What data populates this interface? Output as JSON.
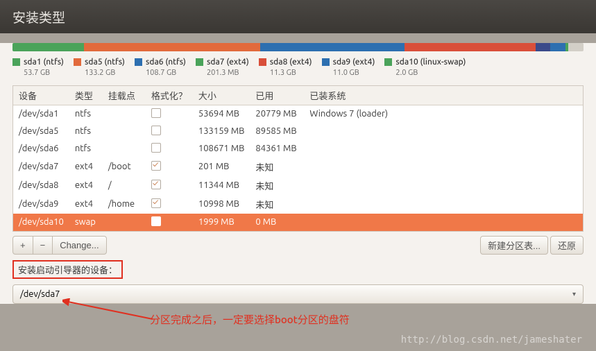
{
  "title": "安装类型",
  "usage_bar": [
    {
      "color": "#4aa35a",
      "pct": 12.5
    },
    {
      "color": "#e26a3c",
      "pct": 30.9
    },
    {
      "color": "#2d6fb0",
      "pct": 25.2
    },
    {
      "color": "#d94f3a",
      "pct": 23.0
    },
    {
      "color": "#3b4a8a",
      "pct": 2.6
    },
    {
      "color": "#2d6fb0",
      "pct": 2.6
    },
    {
      "color": "#4aa35a",
      "pct": 0.5
    },
    {
      "color": "#d3cfc7",
      "pct": 2.7
    }
  ],
  "legend": [
    {
      "color": "#4aa35a",
      "name": "sda1 (ntfs)",
      "size": "53.7 GB"
    },
    {
      "color": "#e26a3c",
      "name": "sda5 (ntfs)",
      "size": "133.2 GB"
    },
    {
      "color": "#2d6fb0",
      "name": "sda6 (ntfs)",
      "size": "108.7 GB"
    },
    {
      "color": "#4aa35a",
      "name": "sda7 (ext4)",
      "size": "201.3 MB"
    },
    {
      "color": "#d94f3a",
      "name": "sda8 (ext4)",
      "size": "11.3 GB"
    },
    {
      "color": "#2d6fb0",
      "name": "sda9 (ext4)",
      "size": "11.0 GB"
    },
    {
      "color": "#4aa35a",
      "name": "sda10 (linux-swap)",
      "size": "2.0 GB"
    }
  ],
  "columns": {
    "device": "设备",
    "type": "类型",
    "mount": "挂载点",
    "format": "格式化？",
    "size": "大小",
    "used": "已用",
    "system": "已装系统"
  },
  "rows": [
    {
      "device": "/dev/sda1",
      "type": "ntfs",
      "mount": "",
      "fmt": false,
      "size": "53694 MB",
      "used": "20779 MB",
      "system": "Windows 7 (loader)",
      "selected": false
    },
    {
      "device": "/dev/sda5",
      "type": "ntfs",
      "mount": "",
      "fmt": false,
      "size": "133159 MB",
      "used": "89585 MB",
      "system": "",
      "selected": false
    },
    {
      "device": "/dev/sda6",
      "type": "ntfs",
      "mount": "",
      "fmt": false,
      "size": "108671 MB",
      "used": "84361 MB",
      "system": "",
      "selected": false
    },
    {
      "device": "/dev/sda7",
      "type": "ext4",
      "mount": "/boot",
      "fmt": true,
      "size": "201 MB",
      "used": "未知",
      "system": "",
      "selected": false
    },
    {
      "device": "/dev/sda8",
      "type": "ext4",
      "mount": "/",
      "fmt": true,
      "size": "11344 MB",
      "used": "未知",
      "system": "",
      "selected": false
    },
    {
      "device": "/dev/sda9",
      "type": "ext4",
      "mount": "/home",
      "fmt": true,
      "size": "10998 MB",
      "used": "未知",
      "system": "",
      "selected": false
    },
    {
      "device": "/dev/sda10",
      "type": "swap",
      "mount": "",
      "fmt": false,
      "size": "1999 MB",
      "used": "0 MB",
      "system": "",
      "selected": true
    }
  ],
  "buttons": {
    "plus": "+",
    "minus": "−",
    "change": "Change...",
    "new_table": "新建分区表...",
    "revert": "还原"
  },
  "bootloader_label": "安装启动引导器的设备：",
  "bootloader_value": "/dev/sda7",
  "annotation_text": "分区完成之后，一定要选择boot分区的盘符",
  "watermark": "http://blog.csdn.net/jameshater"
}
